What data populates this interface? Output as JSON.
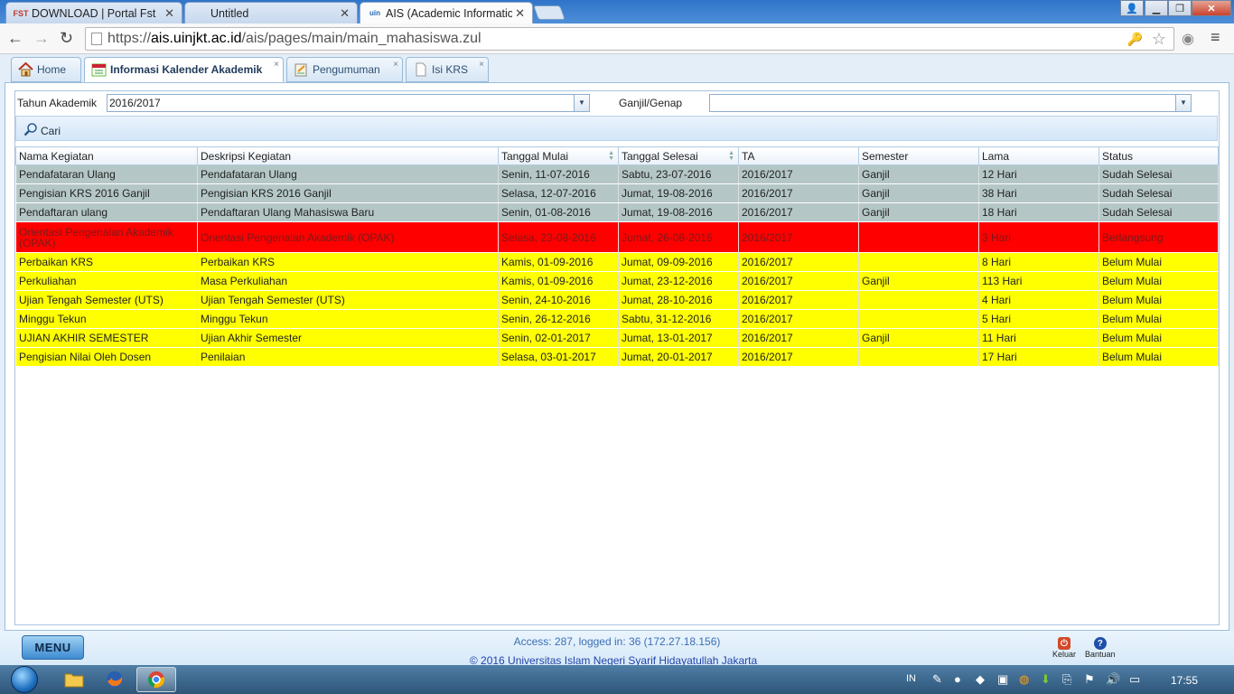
{
  "browser": {
    "tabs": [
      {
        "icon": "FST",
        "title": "DOWNLOAD | Portal Fst"
      },
      {
        "icon": "",
        "title": "Untitled"
      },
      {
        "icon": "uin",
        "title": "AIS (Academic Information"
      }
    ],
    "url_scheme": "https://",
    "url_host": "ais.uinjkt.ac.id",
    "url_path": "/ais/pages/main/main_mahasiswa.zul"
  },
  "app_tabs": [
    {
      "label": "Home",
      "icon": "home-icon"
    },
    {
      "label": "Informasi Kalender Akademik",
      "icon": "calendar-icon"
    },
    {
      "label": "Pengumuman",
      "icon": "announcement-icon"
    },
    {
      "label": "Isi KRS",
      "icon": "document-icon"
    }
  ],
  "filters": {
    "tahun_label": "Tahun Akademik",
    "tahun_value": "2016/2017",
    "semester_label": "Ganjil/Genap",
    "semester_value": "",
    "cari_label": "Cari"
  },
  "table": {
    "headers": [
      "Nama Kegiatan",
      "Deskripsi Kegiatan",
      "Tanggal Mulai",
      "Tanggal Selesai",
      "TA",
      "Semester",
      "Lama",
      "Status"
    ],
    "rows": [
      {
        "status_color": "#b4c7c6",
        "cells": [
          "Pendafataran Ulang",
          "Pendafataran Ulang",
          "Senin, 11-07-2016",
          "Sabtu, 23-07-2016",
          "2016/2017",
          "Ganjil",
          "12 Hari",
          "Sudah Selesai"
        ]
      },
      {
        "status_color": "#b4c7c6",
        "cells": [
          "Pengisian KRS 2016 Ganjil",
          "Pengisian KRS 2016 Ganjil",
          "Selasa, 12-07-2016",
          "Jumat, 19-08-2016",
          "2016/2017",
          "Ganjil",
          "38 Hari",
          "Sudah Selesai"
        ]
      },
      {
        "status_color": "#b4c7c6",
        "cells": [
          "Pendaftaran ulang",
          "Pendaftaran Ulang Mahasiswa Baru",
          "Senin, 01-08-2016",
          "Jumat, 19-08-2016",
          "2016/2017",
          "Ganjil",
          "18 Hari",
          "Sudah Selesai"
        ]
      },
      {
        "status_color": "#ff0000",
        "cells": [
          "Orientasi Pengenalan Akademik (OPAK)",
          "Orientasi Pengenalan Akademik (OPAK)",
          "Selasa, 23-08-2016",
          "Jumat, 26-08-2016",
          "2016/2017",
          "",
          "3 Hari",
          "Berlangsung"
        ]
      },
      {
        "status_color": "#ffff00",
        "cells": [
          "Perbaikan KRS",
          "Perbaikan KRS",
          "Kamis, 01-09-2016",
          "Jumat, 09-09-2016",
          "2016/2017",
          "",
          "8 Hari",
          "Belum Mulai"
        ]
      },
      {
        "status_color": "#ffff00",
        "cells": [
          "Perkuliahan",
          "Masa Perkuliahan",
          "Kamis, 01-09-2016",
          "Jumat, 23-12-2016",
          "2016/2017",
          "Ganjil",
          "113 Hari",
          "Belum Mulai"
        ]
      },
      {
        "status_color": "#ffff00",
        "cells": [
          "Ujian Tengah Semester (UTS)",
          "Ujian Tengah Semester (UTS)",
          "Senin, 24-10-2016",
          "Jumat, 28-10-2016",
          "2016/2017",
          "",
          "4 Hari",
          "Belum Mulai"
        ]
      },
      {
        "status_color": "#ffff00",
        "cells": [
          "Minggu Tekun",
          "Minggu Tekun",
          "Senin, 26-12-2016",
          "Sabtu, 31-12-2016",
          "2016/2017",
          "",
          "5 Hari",
          "Belum Mulai"
        ]
      },
      {
        "status_color": "#ffff00",
        "cells": [
          "UJIAN AKHIR SEMESTER",
          "Ujian Akhir Semester",
          "Senin, 02-01-2017",
          "Jumat, 13-01-2017",
          "2016/2017",
          "Ganjil",
          "11 Hari",
          "Belum Mulai"
        ]
      },
      {
        "status_color": "#ffff00",
        "cells": [
          "Pengisian Nilai Oleh Dosen",
          "Penilaian",
          "Selasa, 03-01-2017",
          "Jumat, 20-01-2017",
          "2016/2017",
          "",
          "17 Hari",
          "Belum Mulai"
        ]
      }
    ]
  },
  "footer": {
    "menu_label": "MENU",
    "access_text": "Access: 287, logged in: 36 (172.27.18.156)",
    "copyright": "© 2016 Universitas Islam Negeri Syarif Hidayatullah Jakarta",
    "keluar_label": "Keluar",
    "bantuan_label": "Bantuan"
  },
  "taskbar": {
    "lang": "IN",
    "clock": "17:55"
  }
}
